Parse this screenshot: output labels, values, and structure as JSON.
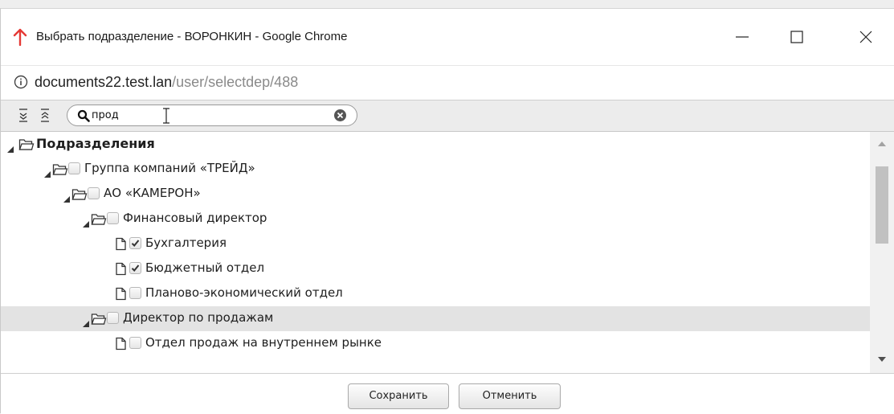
{
  "window": {
    "title": "Выбрать подразделение - ВОРОНКИН - Google Chrome"
  },
  "address": {
    "host": "documents22.test.lan",
    "path": "/user/selectdep/488"
  },
  "search": {
    "value": "прод"
  },
  "tree": [
    {
      "label": "Подразделения",
      "level": 0,
      "type": "root",
      "expanded": true
    },
    {
      "label": "Группа компаний «ТРЕЙД»",
      "level": 1,
      "type": "folder",
      "checked": false
    },
    {
      "label": "АО «КАМЕРОН»",
      "level": 2,
      "type": "folder",
      "checked": false
    },
    {
      "label": "Финансовый директор",
      "level": 3,
      "type": "folder",
      "checked": false
    },
    {
      "label": "Бухгалтерия",
      "level": 4,
      "type": "file",
      "checked": true
    },
    {
      "label": "Бюджетный отдел",
      "level": 4,
      "type": "file",
      "checked": true
    },
    {
      "label": "Планово-экономический отдел",
      "level": 4,
      "type": "file",
      "checked": false
    },
    {
      "label": "Директор по продажам",
      "level": 3,
      "type": "folder",
      "checked": false,
      "highlighted": true
    },
    {
      "label": "Отдел продаж на внутреннем рынке",
      "level": 4,
      "type": "file",
      "checked": false
    }
  ],
  "footer": {
    "save": "Сохранить",
    "cancel": "Отменить"
  },
  "icons": {
    "app": "red-arrow-up-icon",
    "info": "info-circle-icon",
    "expand_all": "expand-all-icon",
    "collapse_all": "collapse-all-icon",
    "search": "magnifier-icon",
    "clear": "clear-circle-x-icon"
  },
  "colors": {
    "app_icon": "#e53935",
    "highlight_row": "#e3e3e3",
    "toolbar": "#ececec"
  }
}
